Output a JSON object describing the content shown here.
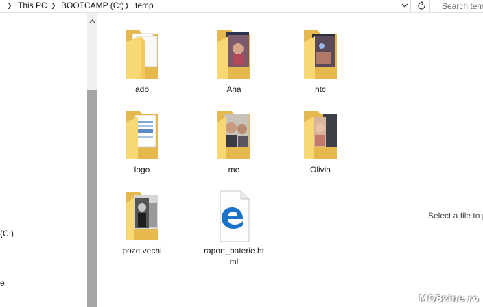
{
  "address_bar": {
    "crumbs": [
      "This PC",
      "BOOTCAMP (C:)",
      "temp"
    ]
  },
  "search": {
    "placeholder": "Search tem"
  },
  "nav_pane": {
    "items": [
      "(C:)",
      "e"
    ]
  },
  "files": [
    {
      "name": "adb",
      "type": "folder",
      "preview": "documents"
    },
    {
      "name": "Ana",
      "type": "folder",
      "preview": "photos"
    },
    {
      "name": "htc",
      "type": "folder",
      "preview": "photos-dark"
    },
    {
      "name": "logo",
      "type": "folder",
      "preview": "documents-blue"
    },
    {
      "name": "me",
      "type": "folder",
      "preview": "portraits"
    },
    {
      "name": "Olivia",
      "type": "folder",
      "preview": "photos"
    },
    {
      "name": "poze vechi",
      "type": "folder",
      "preview": "bw-photos"
    },
    {
      "name": "raport_baterie.html",
      "type": "html-file",
      "icon": "edge-icon"
    }
  ],
  "preview_pane": {
    "message": "Select a file to p"
  },
  "watermark": "MOBzine.ro",
  "colors": {
    "folder_back": "#e5b94e",
    "folder_front": "#f8d775",
    "edge_blue": "#1a73c8",
    "scroll_thumb": "#a6a6a6"
  }
}
